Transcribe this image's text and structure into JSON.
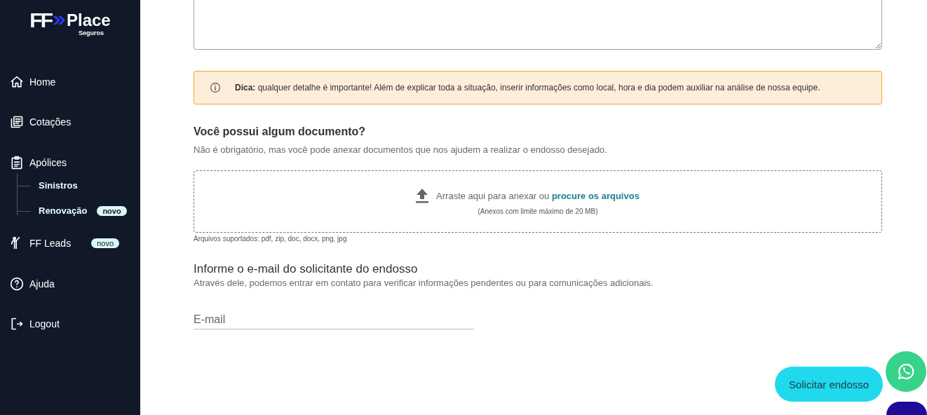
{
  "logo": {
    "mark": "FF",
    "name": "Place",
    "tagline": "Seguros"
  },
  "sidebar": {
    "items": [
      {
        "kind": "home",
        "label": "Home"
      },
      {
        "kind": "quotes",
        "label": "Cotações"
      },
      {
        "kind": "policies",
        "label": "Apólices",
        "children": [
          {
            "label": "Sinistros"
          },
          {
            "label": "Renovação",
            "badge": "novo"
          }
        ]
      },
      {
        "kind": "leads",
        "label": "FF Leads",
        "badge": "novo"
      },
      {
        "kind": "help",
        "label": "Ajuda"
      },
      {
        "kind": "logout",
        "label": "Logout"
      }
    ]
  },
  "tip": {
    "text": "**Dica:** qualquer detalhe é importante! Além de explicar toda a situação, inserir informações como local, hora e dia podem auxiliar na análise de nossa equipe."
  },
  "documents": {
    "title": "Você possui algum documento?",
    "subtitle": "Não é obrigatório, mas você pode anexar documentos que nos ajudem a realizar o endosso desejado.",
    "drop_text": "Arraste aqui para anexar ou",
    "drop_link": "procure os arquivos",
    "limit": "(Anexos com limite máximo de 20 MB)",
    "supported": "Arquivos suportados: pdf, zip, doc, docx, png, jpg"
  },
  "email": {
    "title": "Informe o e-mail do solicitante do endosso",
    "subtitle": "Através dele, podemos entrar em contato para verificar informações pendentes ou para comunicações adicionais.",
    "placeholder": "E-mail"
  },
  "submit": {
    "label": "Solicitar endosso"
  }
}
